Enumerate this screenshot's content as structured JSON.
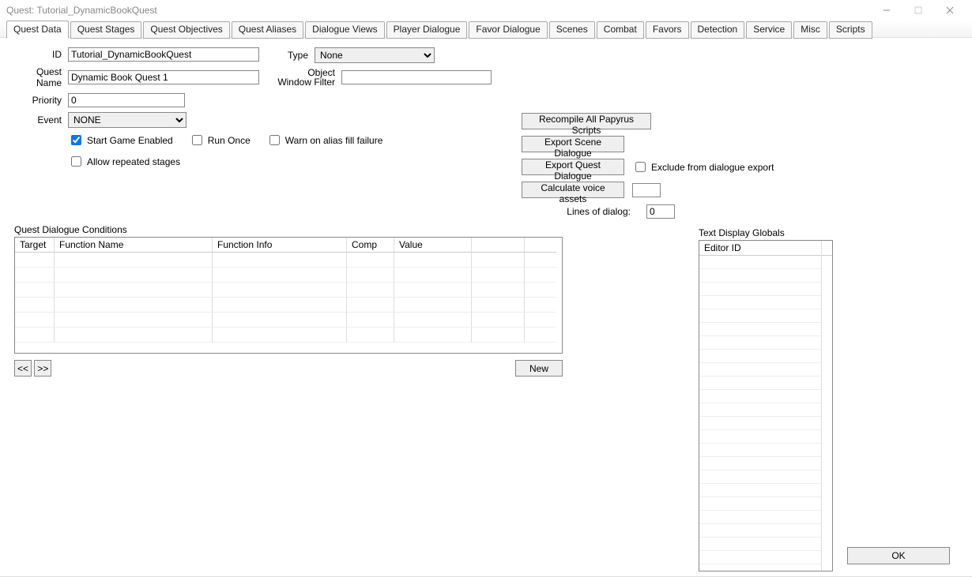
{
  "window": {
    "title": "Quest: Tutorial_DynamicBookQuest"
  },
  "tabs": [
    "Quest Data",
    "Quest Stages",
    "Quest Objectives",
    "Quest Aliases",
    "Dialogue Views",
    "Player Dialogue",
    "Favor Dialogue",
    "Scenes",
    "Combat",
    "Favors",
    "Detection",
    "Service",
    "Misc",
    "Scripts"
  ],
  "active_tab": 0,
  "fields": {
    "id_label": "ID",
    "id_value": "Tutorial_DynamicBookQuest",
    "name_label": "Quest Name",
    "name_value": "Dynamic Book Quest 1",
    "priority_label": "Priority",
    "priority_value": "0",
    "event_label": "Event",
    "event_value": "NONE",
    "type_label": "Type",
    "type_value": "None",
    "owf_label": "Object Window Filter",
    "owf_value": ""
  },
  "checks": {
    "start_game": "Start Game Enabled",
    "start_game_checked": true,
    "run_once": "Run Once",
    "run_once_checked": false,
    "warn_alias": "Warn on alias fill failure",
    "warn_alias_checked": false,
    "allow_repeated": "Allow repeated stages",
    "allow_repeated_checked": false,
    "exclude_export": "Exclude from dialogue export",
    "exclude_export_checked": false
  },
  "actions": {
    "recompile": "Recompile All Papyrus Scripts",
    "export_scene": "Export Scene Dialogue",
    "export_quest": "Export Quest Dialogue",
    "calc_voice": "Calculate voice assets",
    "lines_label": "Lines of dialog:",
    "lines_value": "0",
    "voice_box_value": ""
  },
  "cond": {
    "header": "Quest Dialogue Conditions",
    "cols": {
      "target": "Target",
      "fn": "Function Name",
      "info": "Function Info",
      "comp": "Comp",
      "value": "Value"
    },
    "prev": "<<",
    "next": ">>",
    "new": "New"
  },
  "globals": {
    "header": "Text Display Globals",
    "col": "Editor ID"
  },
  "ok": "OK"
}
